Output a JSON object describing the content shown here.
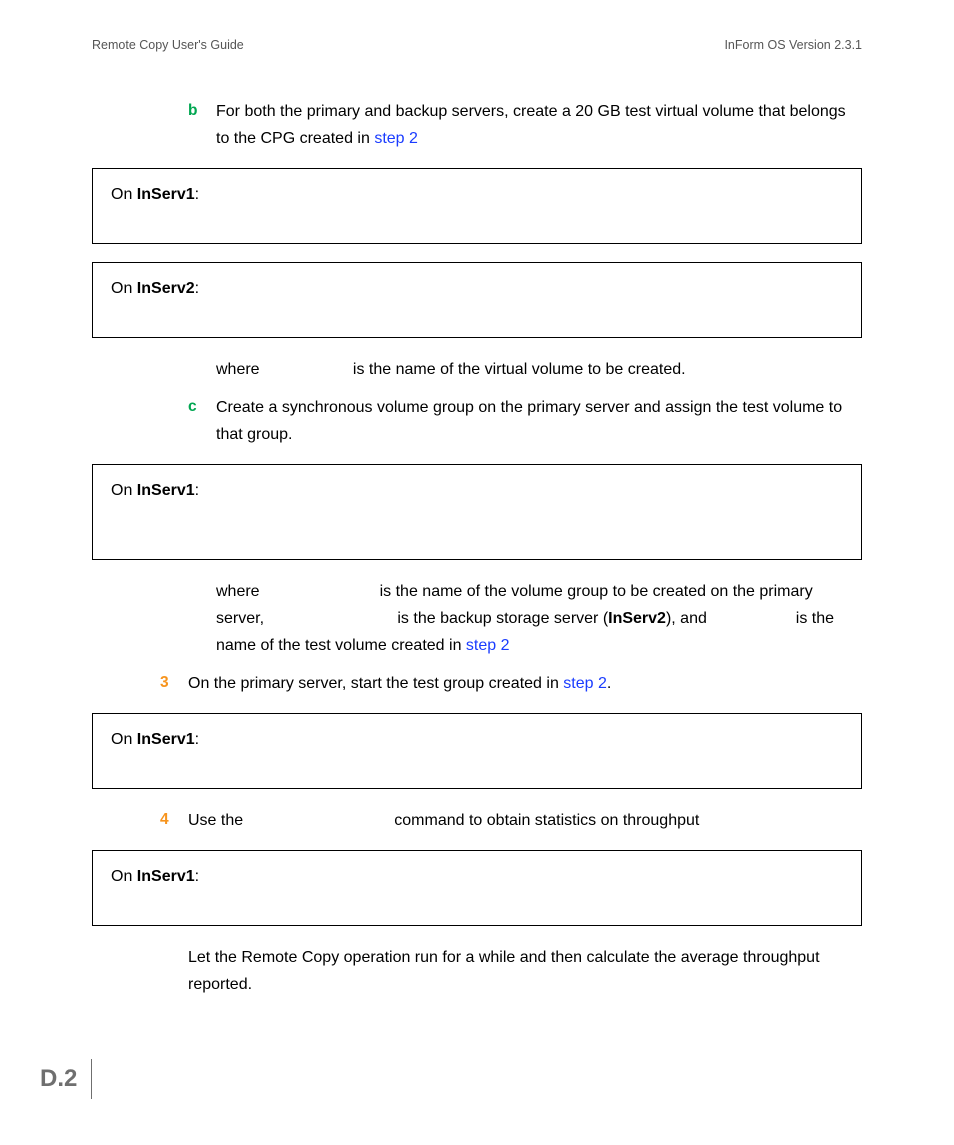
{
  "header": {
    "left": "Remote Copy User's Guide",
    "right": "InForm OS Version 2.3.1"
  },
  "step_b_marker": "b",
  "step_b_text_pre": "For both the primary and backup servers, create a 20 GB test virtual volume that belongs to the CPG created in ",
  "step_b_link": "step 2",
  "box1_on": "On ",
  "box1_name": "InServ1",
  "box1_colon": ":",
  "box2_on": "On ",
  "box2_name": "InServ2",
  "box2_colon": ":",
  "where_b": "where                     is the name of the virtual volume to be created.",
  "step_c_marker": "c",
  "step_c_text": "Create a synchronous volume group on the primary server and assign the test volume to that group.",
  "box3_on": "On ",
  "box3_name": "InServ1",
  "box3_colon": ":",
  "where_c_1": "where                           is the name of the volume group to be created on the primary server,                              is the backup storage server (",
  "where_c_mid_bold": "InServ2",
  "where_c_2": "), and                    is the name of the test volume created in ",
  "where_c_link": "step 2",
  "step_3_marker": "3",
  "step_3_text_pre": "On the primary server, start the test group created in ",
  "step_3_link": "step 2",
  "step_3_dot": ".",
  "box4_on": "On ",
  "box4_name": "InServ1",
  "box4_colon": ":",
  "step_4_marker": "4",
  "step_4_text": "Use the                                  command to obtain statistics on throughput",
  "box5_on": "On ",
  "box5_name": "InServ1",
  "box5_colon": ":",
  "final_para": "Let the Remote Copy operation run for a while and then calculate the average throughput reported.",
  "page_number": "D.2"
}
